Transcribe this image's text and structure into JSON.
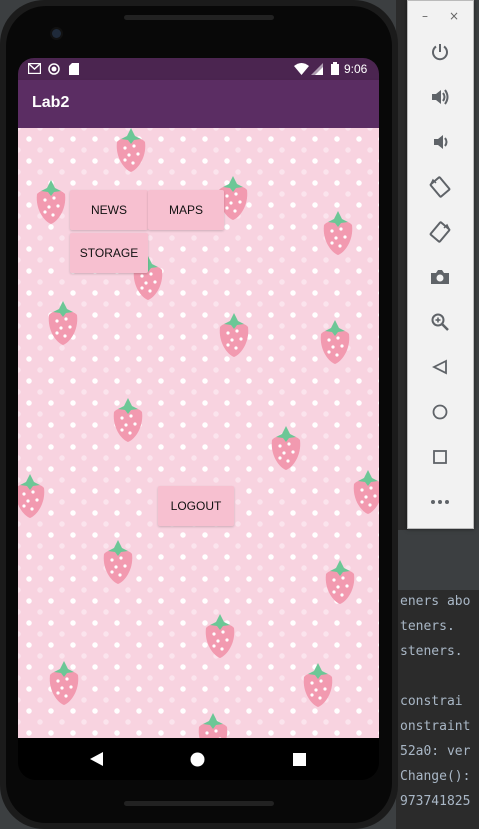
{
  "status_bar": {
    "time": "9:06",
    "notification_icons": [
      "gmail-icon",
      "record-icon",
      "sd-card-icon"
    ],
    "system_icons": [
      "wifi-icon",
      "signal-icon",
      "battery-icon"
    ]
  },
  "app": {
    "title": "Lab2",
    "colors": {
      "status_bar": "#4b2550",
      "app_bar": "#5b2d63",
      "button": "#f7c0d0"
    }
  },
  "buttons": {
    "news": "NEWS",
    "maps": "MAPS",
    "storage": "STORAGE",
    "logout": "LOGOUT"
  },
  "nav_bar": {
    "icons": [
      "back-icon",
      "home-icon",
      "recents-icon"
    ]
  },
  "emulator_panel": {
    "window_controls": [
      "–",
      "×"
    ],
    "icons": [
      "power-icon",
      "volume-up-icon",
      "volume-down-icon",
      "rotate-left-icon",
      "rotate-right-icon",
      "camera-icon",
      "zoom-icon",
      "back-icon",
      "home-icon",
      "overview-icon",
      "more-icon"
    ]
  },
  "ide_console": {
    "lines": [
      "eners abo",
      "teners.",
      "steners.",
      " constrai",
      "onstraint",
      "52a0: ver",
      "Change():",
      "973741825"
    ]
  }
}
